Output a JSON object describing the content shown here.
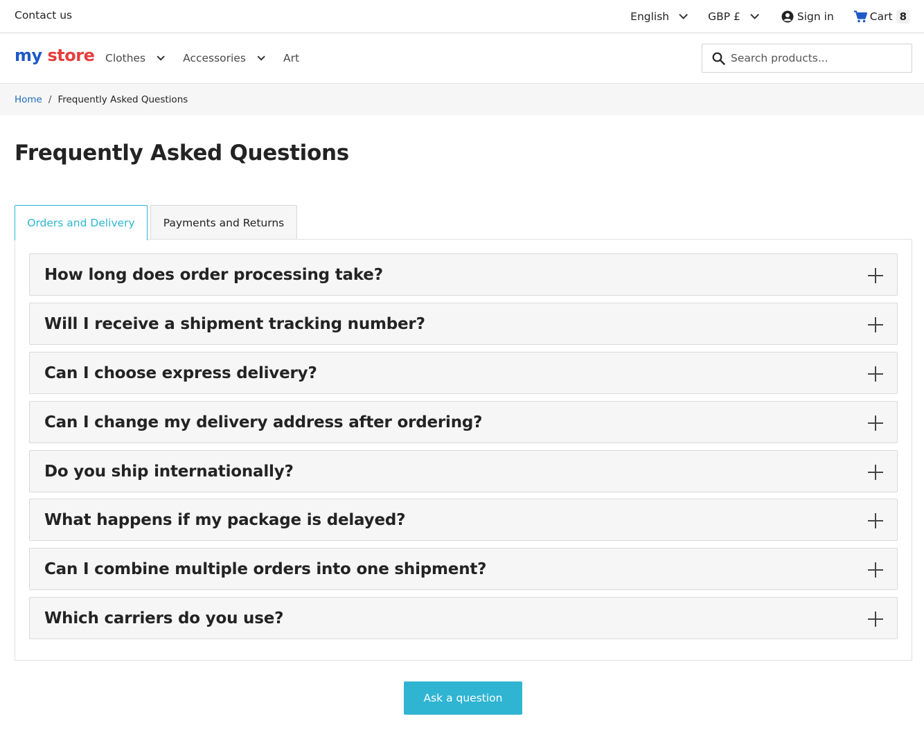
{
  "topbar": {
    "contact": "Contact us",
    "language": "English",
    "currency": "GBP £",
    "signin": "Sign in",
    "cart_label": "Cart",
    "cart_count": "8"
  },
  "header": {
    "logo": {
      "part1": "my",
      "part2": "store"
    },
    "nav": [
      {
        "label": "Clothes",
        "has_dropdown": true
      },
      {
        "label": "Accessories",
        "has_dropdown": true
      },
      {
        "label": "Art",
        "has_dropdown": false
      }
    ],
    "search_placeholder": "Search products..."
  },
  "breadcrumb": {
    "home": "Home",
    "separator": "/",
    "current": "Frequently Asked Questions"
  },
  "page": {
    "title": "Frequently Asked Questions",
    "tabs": [
      {
        "label": "Orders and Delivery",
        "active": true
      },
      {
        "label": "Payments and Returns",
        "active": false
      }
    ],
    "questions": [
      "How long does order processing take?",
      "Will I receive a shipment tracking number?",
      "Can I choose express delivery?",
      "Can I change my delivery address after ordering?",
      "Do you ship internationally?",
      "What happens if my package is delayed?",
      "Can I combine multiple orders into one shipment?",
      "Which carriers do you use?"
    ],
    "ask_button": "Ask a question"
  },
  "colors": {
    "accent": "#2fb5d2",
    "link": "#1f6bb8",
    "text": "#232323",
    "panel_bg": "#f6f6f7",
    "cart_icon": "#1f59c7"
  }
}
